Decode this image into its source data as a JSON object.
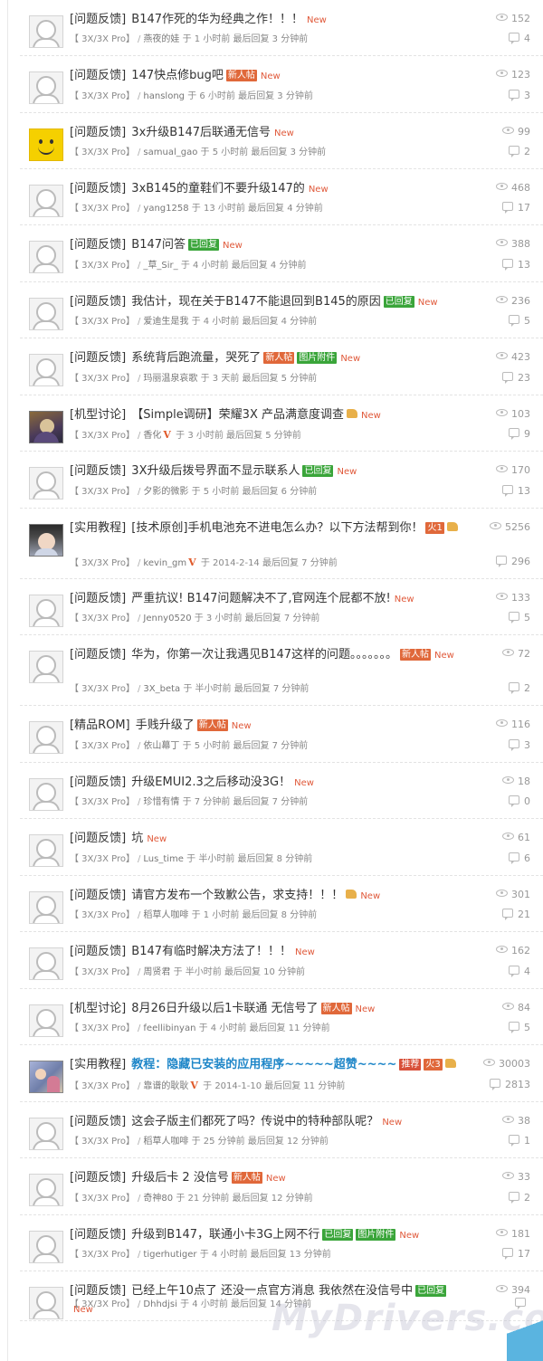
{
  "watermark": "MyDrivers.com",
  "labels": {
    "new": "New",
    "thumb": "thumbs-up-icon",
    "v_badge": "V"
  },
  "threads": [
    {
      "category": "[问题反馈]",
      "title": "B147作死的华为经典之作！！！",
      "tags": [],
      "thumb": false,
      "new": true,
      "forum": "【 3X/3X Pro】",
      "author": "燕夜的娃",
      "vip": false,
      "time": "于 1 小时前 最后回复 3 分钟前",
      "views": "152",
      "replies": "4",
      "avatar": "default"
    },
    {
      "category": "[问题反馈]",
      "title": "147快点修bug吧",
      "tags": [
        "新人帖"
      ],
      "thumb": false,
      "new": true,
      "forum": "【 3X/3X Pro】",
      "author": "hanslong",
      "vip": false,
      "time": "于 6 小时前 最后回复 3 分钟前",
      "views": "123",
      "replies": "3",
      "avatar": "default"
    },
    {
      "category": "[问题反馈]",
      "title": "3x升级B147后联通无信号",
      "tags": [],
      "thumb": false,
      "new": true,
      "forum": "【 3X/3X Pro】",
      "author": "samual_gao",
      "vip": false,
      "time": "于 5 小时前 最后回复 3 分钟前",
      "views": "99",
      "replies": "2",
      "avatar": "smiley"
    },
    {
      "category": "[问题反馈]",
      "title": "3xB145的童鞋们不要升级147的",
      "tags": [],
      "thumb": false,
      "new": true,
      "forum": "【 3X/3X Pro】",
      "author": "yang1258",
      "vip": false,
      "time": "于 13 小时前 最后回复 4 分钟前",
      "views": "468",
      "replies": "17",
      "avatar": "default"
    },
    {
      "category": "[问题反馈]",
      "title": "B147问答",
      "tags": [
        "已回复"
      ],
      "thumb": false,
      "new": true,
      "forum": "【 3X/3X Pro】",
      "author": "_草_Sir_",
      "vip": false,
      "time": "于 4 小时前 最后回复 4 分钟前",
      "views": "388",
      "replies": "13",
      "avatar": "default"
    },
    {
      "category": "[问题反馈]",
      "title": "我估计，现在关于B147不能退回到B145的原因",
      "tags": [
        "已回复"
      ],
      "thumb": false,
      "new": true,
      "forum": "【 3X/3X Pro】",
      "author": "爱迪生是我",
      "vip": false,
      "time": "于 4 小时前 最后回复 4 分钟前",
      "views": "236",
      "replies": "5",
      "avatar": "default"
    },
    {
      "category": "[问题反馈]",
      "title": "系统背后跑流量，哭死了",
      "tags": [
        "新人帖",
        "图片附件"
      ],
      "thumb": false,
      "new": true,
      "forum": "【 3X/3X Pro】",
      "author": "玛丽温泉哀歌",
      "vip": false,
      "time": "于 3 天前 最后回复 5 分钟前",
      "views": "423",
      "replies": "23",
      "avatar": "default"
    },
    {
      "category": "[机型讨论]",
      "title": "【Simple调研】荣耀3X 产品满意度调查",
      "tags": [],
      "thumb": true,
      "new": true,
      "forum": "【 3X/3X Pro】",
      "author": "香化",
      "vip": true,
      "time": "于 3 小时前 最后回复 5 分钟前",
      "views": "103",
      "replies": "9",
      "avatar": "wizard"
    },
    {
      "category": "[问题反馈]",
      "title": "3X升级后拨号界面不显示联系人",
      "tags": [
        "已回复"
      ],
      "thumb": false,
      "new": true,
      "forum": "【 3X/3X Pro】",
      "author": "夕影的微影",
      "vip": false,
      "time": "于 5 小时前 最后回复 6 分钟前",
      "views": "170",
      "replies": "13",
      "avatar": "default"
    },
    {
      "category": "[实用教程]",
      "title": "[技术原创]手机电池充不进电怎么办？以下方法帮到你！",
      "tags": [
        "火1"
      ],
      "thumb": true,
      "new": false,
      "forum": "【 3X/3X Pro】",
      "author": "kevin_gm",
      "vip": true,
      "time": "于 2014-2-14 最后回复 7 分钟前",
      "views": "5256",
      "replies": "296",
      "avatar": "girl"
    },
    {
      "category": "[问题反馈]",
      "title": "严重抗议! B147问题解决不了,官网连个屁都不放!",
      "tags": [],
      "thumb": false,
      "new": true,
      "forum": "【 3X/3X Pro】",
      "author": "Jenny0520",
      "vip": false,
      "time": "于 3 小时前 最后回复 7 分钟前",
      "views": "133",
      "replies": "5",
      "avatar": "default"
    },
    {
      "category": "[问题反馈]",
      "title": "华为，你第一次让我遇见B147这样的问题。。。。。。。",
      "tags": [
        "新人帖"
      ],
      "thumb": false,
      "new": true,
      "forum": "【 3X/3X Pro】",
      "author": "3X_beta",
      "vip": false,
      "time": "于 半小时前 最后回复 7 分钟前",
      "views": "72",
      "replies": "2",
      "avatar": "default"
    },
    {
      "category": "[精品ROM]",
      "title": "手贱升级了",
      "tags": [
        "新人帖"
      ],
      "thumb": false,
      "new": true,
      "forum": "【 3X/3X Pro】",
      "author": "依山幕丁",
      "vip": false,
      "time": "于 5 小时前 最后回复 7 分钟前",
      "views": "116",
      "replies": "3",
      "avatar": "default"
    },
    {
      "category": "[问题反馈]",
      "title": "升级EMUI2.3之后移动没3G！",
      "tags": [],
      "thumb": false,
      "new": true,
      "forum": "【 3X/3X Pro】",
      "author": "珍惜有情",
      "vip": false,
      "time": "于 7 分钟前 最后回复 7 分钟前",
      "views": "18",
      "replies": "0",
      "avatar": "default"
    },
    {
      "category": "[问题反馈]",
      "title": "坑",
      "tags": [],
      "thumb": false,
      "new": true,
      "forum": "【 3X/3X Pro】",
      "author": "Lus_time",
      "vip": false,
      "time": "于 半小时前 最后回复 8 分钟前",
      "views": "61",
      "replies": "6",
      "avatar": "default"
    },
    {
      "category": "[问题反馈]",
      "title": "请官方发布一个致歉公告，求支持！！！",
      "tags": [],
      "thumb": true,
      "new": true,
      "forum": "【 3X/3X Pro】",
      "author": "稻草人咖啡",
      "vip": false,
      "time": "于 1 小时前 最后回复 8 分钟前",
      "views": "301",
      "replies": "21",
      "avatar": "default"
    },
    {
      "category": "[问题反馈]",
      "title": "B147有临时解决方法了！！！",
      "tags": [],
      "thumb": false,
      "new": true,
      "forum": "【 3X/3X Pro】",
      "author": "周贤君",
      "vip": false,
      "time": "于 半小时前 最后回复 10 分钟前",
      "views": "162",
      "replies": "4",
      "avatar": "default"
    },
    {
      "category": "[机型讨论]",
      "title": "8月26日升级以后1卡联通 无信号了",
      "tags": [
        "新人帖"
      ],
      "thumb": false,
      "new": true,
      "forum": "【 3X/3X Pro】",
      "author": "feellibinyan",
      "vip": false,
      "time": "于 4 小时前 最后回复 11 分钟前",
      "views": "84",
      "replies": "5",
      "avatar": "default"
    },
    {
      "category": "[实用教程]",
      "title": "教程：隐藏已安装的应用程序~~~~~超赞~~~~",
      "tags": [
        "推荐",
        "火3"
      ],
      "thumb": true,
      "new": false,
      "bold": true,
      "forum": "【 3X/3X Pro】",
      "author": "靠谱的耿耿",
      "vip": true,
      "time": "于 2014-1-10 最后回复 11 分钟前",
      "views": "30003",
      "replies": "2813",
      "avatar": "couple"
    },
    {
      "category": "[问题反馈]",
      "title": "这会子版主们都死了吗？传说中的特种部队呢？",
      "tags": [],
      "thumb": false,
      "new": true,
      "forum": "【 3X/3X Pro】",
      "author": "稻草人咖啡",
      "vip": false,
      "time": "于 25 分钟前 最后回复 12 分钟前",
      "views": "38",
      "replies": "1",
      "avatar": "default"
    },
    {
      "category": "[问题反馈]",
      "title": "升级后卡 2 没信号",
      "tags": [
        "新人帖"
      ],
      "thumb": false,
      "new": true,
      "forum": "【 3X/3X Pro】",
      "author": "奇神80",
      "vip": false,
      "time": "于 21 分钟前 最后回复 12 分钟前",
      "views": "33",
      "replies": "2",
      "avatar": "default"
    },
    {
      "category": "[问题反馈]",
      "title": "升级到B147，联通小卡3G上网不行",
      "tags": [
        "已回复",
        "图片附件"
      ],
      "thumb": false,
      "new": true,
      "forum": "【 3X/3X Pro】",
      "author": "tigerhutiger",
      "vip": false,
      "time": "于 4 小时前 最后回复 13 分钟前",
      "views": "181",
      "replies": "17",
      "avatar": "default"
    },
    {
      "category": "[问题反馈]",
      "title": "已经上午10点了 还没一点官方消息 我依然在没信号中",
      "tags": [
        "已回复"
      ],
      "thumb": false,
      "new": true,
      "forum": "【 3X/3X Pro】",
      "author": "Dhhdjsi",
      "vip": false,
      "time": "于 4 小时前 最后回复 14 分钟前",
      "views": "394",
      "replies": "",
      "avatar": "default"
    }
  ]
}
